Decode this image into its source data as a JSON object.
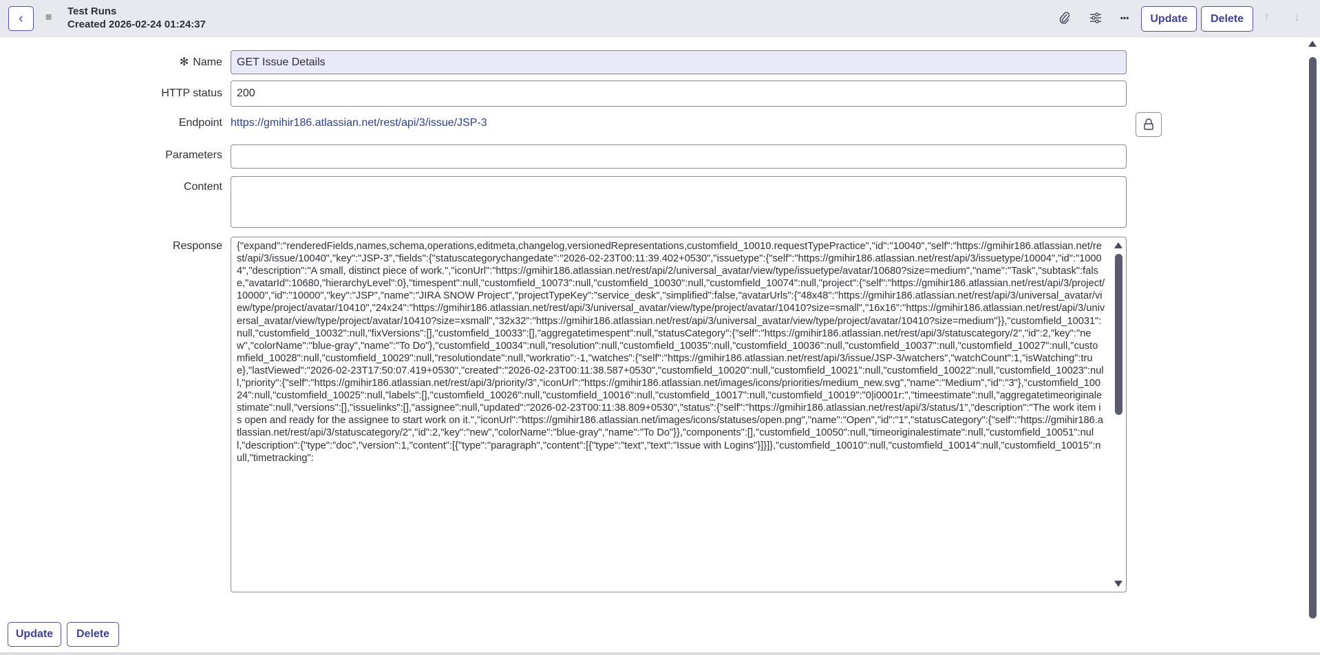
{
  "header": {
    "title": "Test Runs",
    "subtitle": "Created 2026-02-24 01:24:37",
    "update_label": "Update",
    "delete_label": "Delete",
    "more_label": "•••"
  },
  "form": {
    "name_label": "Name",
    "required_mark": "✻",
    "name_value": "GET Issue Details",
    "http_status_label": "HTTP status",
    "http_status_value": "200",
    "endpoint_label": "Endpoint",
    "endpoint_value": "https://gmihir186.atlassian.net/rest/api/3/issue/JSP-3",
    "parameters_label": "Parameters",
    "parameters_value": "",
    "content_label": "Content",
    "content_value": "",
    "response_label": "Response",
    "response_value": "{\"expand\":\"renderedFields,names,schema,operations,editmeta,changelog,versionedRepresentations,customfield_10010.requestTypePractice\",\"id\":\"10040\",\"self\":\"https://gmihir186.atlassian.net/rest/api/3/issue/10040\",\"key\":\"JSP-3\",\"fields\":{\"statuscategorychangedate\":\"2026-02-23T00:11:39.402+0530\",\"issuetype\":{\"self\":\"https://gmihir186.atlassian.net/rest/api/3/issuetype/10004\",\"id\":\"10004\",\"description\":\"A small, distinct piece of work.\",\"iconUrl\":\"https://gmihir186.atlassian.net/rest/api/2/universal_avatar/view/type/issuetype/avatar/10680?size=medium\",\"name\":\"Task\",\"subtask\":false,\"avatarId\":10680,\"hierarchyLevel\":0},\"timespent\":null,\"customfield_10073\":null,\"customfield_10030\":null,\"customfield_10074\":null,\"project\":{\"self\":\"https://gmihir186.atlassian.net/rest/api/3/project/10000\",\"id\":\"10000\",\"key\":\"JSP\",\"name\":\"JIRA SNOW Project\",\"projectTypeKey\":\"service_desk\",\"simplified\":false,\"avatarUrls\":{\"48x48\":\"https://gmihir186.atlassian.net/rest/api/3/universal_avatar/view/type/project/avatar/10410\",\"24x24\":\"https://gmihir186.atlassian.net/rest/api/3/universal_avatar/view/type/project/avatar/10410?size=small\",\"16x16\":\"https://gmihir186.atlassian.net/rest/api/3/universal_avatar/view/type/project/avatar/10410?size=xsmall\",\"32x32\":\"https://gmihir186.atlassian.net/rest/api/3/universal_avatar/view/type/project/avatar/10410?size=medium\"}},\"customfield_10031\":null,\"customfield_10032\":null,\"fixVersions\":[],\"customfield_10033\":[],\"aggregatetimespent\":null,\"statusCategory\":{\"self\":\"https://gmihir186.atlassian.net/rest/api/3/statuscategory/2\",\"id\":2,\"key\":\"new\",\"colorName\":\"blue-gray\",\"name\":\"To Do\"},\"customfield_10034\":null,\"resolution\":null,\"customfield_10035\":null,\"customfield_10036\":null,\"customfield_10037\":null,\"customfield_10027\":null,\"customfield_10028\":null,\"customfield_10029\":null,\"resolutiondate\":null,\"workratio\":-1,\"watches\":{\"self\":\"https://gmihir186.atlassian.net/rest/api/3/issue/JSP-3/watchers\",\"watchCount\":1,\"isWatching\":true},\"lastViewed\":\"2026-02-23T17:50:07.419+0530\",\"created\":\"2026-02-23T00:11:38.587+0530\",\"customfield_10020\":null,\"customfield_10021\":null,\"customfield_10022\":null,\"customfield_10023\":null,\"priority\":{\"self\":\"https://gmihir186.atlassian.net/rest/api/3/priority/3\",\"iconUrl\":\"https://gmihir186.atlassian.net/images/icons/priorities/medium_new.svg\",\"name\":\"Medium\",\"id\":\"3\"},\"customfield_10024\":null,\"customfield_10025\":null,\"labels\":[],\"customfield_10026\":null,\"customfield_10016\":null,\"customfield_10017\":null,\"customfield_10019\":\"0|i0001r:\",\"timeestimate\":null,\"aggregatetimeoriginalestimate\":null,\"versions\":[],\"issuelinks\":[],\"assignee\":null,\"updated\":\"2026-02-23T00:11:38.809+0530\",\"status\":{\"self\":\"https://gmihir186.atlassian.net/rest/api/3/status/1\",\"description\":\"The work item is open and ready for the assignee to start work on it.\",\"iconUrl\":\"https://gmihir186.atlassian.net/images/icons/statuses/open.png\",\"name\":\"Open\",\"id\":\"1\",\"statusCategory\":{\"self\":\"https://gmihir186.atlassian.net/rest/api/3/statuscategory/2\",\"id\":2,\"key\":\"new\",\"colorName\":\"blue-gray\",\"name\":\"To Do\"}},\"components\":[],\"customfield_10050\":null,\"timeoriginalestimate\":null,\"customfield_10051\":null,\"description\":{\"type\":\"doc\",\"version\":1,\"content\":[{\"type\":\"paragraph\",\"content\":[{\"type\":\"text\",\"text\":\"Issue with Logins\"}]}]},\"customfield_10010\":null,\"customfield_10014\":null,\"customfield_10015\":null,\"timetracking\":"
  },
  "footer": {
    "update_label": "Update",
    "delete_label": "Delete"
  },
  "colors": {
    "accent": "#4f52a8",
    "header_bg": "#e8e9ee",
    "link": "#2d3f8c"
  }
}
